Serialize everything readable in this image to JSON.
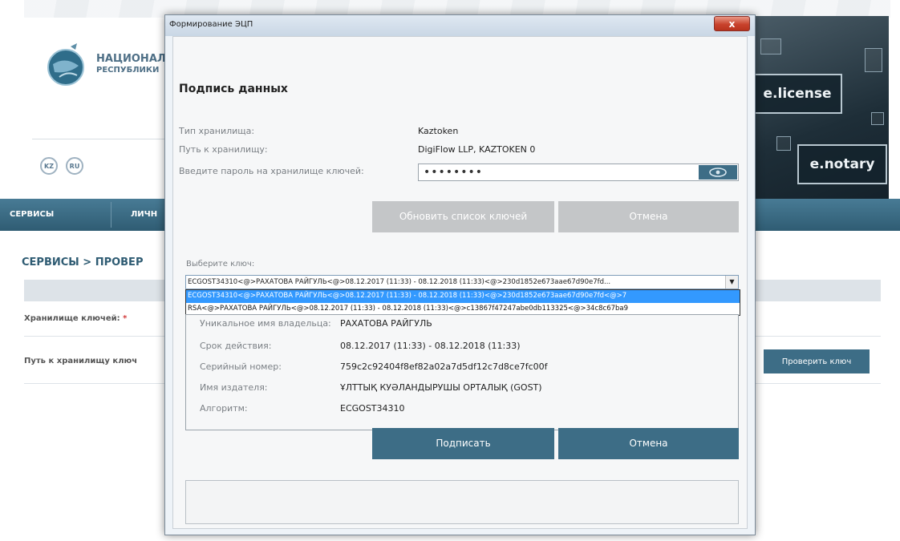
{
  "site": {
    "title": "НАЦИОНАЛ",
    "subtitle": "РЕСПУБЛИКИ",
    "lang_kz": "KZ",
    "lang_ru": "RU",
    "banner_license": "e.license",
    "banner_notary": "e.notary",
    "nav": [
      "СЕРВИСЫ",
      "ЛИЧН"
    ],
    "breadcrumb": "СЕРВИСЫ > ПРОВЕР",
    "label_storage": "Хранилище ключей:",
    "label_required": "*",
    "label_path": "Путь к хранилищу ключ",
    "check_button": "Проверить ключ"
  },
  "dialog": {
    "window_title": "Формирование ЭЦП",
    "close_label": "x",
    "heading": "Подпись данных",
    "storage_type_label": "Тип хранилища:",
    "storage_type_value": "Kaztoken",
    "storage_path_label": "Путь к хранилищу:",
    "storage_path_value": "DigiFlow LLP, KAZTOKEN 0",
    "password_label": "Введите пароль на хранилище ключей:",
    "password_value": "••••••••",
    "refresh_button": "Обновить список ключей",
    "cancel_top_button": "Отмена",
    "select_key_label": "Выберите ключ:",
    "selected_key": "ECGOST34310<@>РАХАТОВА РАЙГУЛЬ<@>08.12.2017 (11:33) - 08.12.2018 (11:33)<@>230d1852e673aae67d90e7fd...",
    "dropdown_options": [
      "ECGOST34310<@>РАХАТОВА РАЙГУЛЬ<@>08.12.2017 (11:33) - 08.12.2018 (11:33)<@>230d1852e673aae67d90e7fd<@>7",
      "RSA<@>РАХАТОВА РАЙГУЛЬ<@>08.12.2017 (11:33) - 08.12.2018 (11:33)<@>c13867f47247abe0db113325<@>34c8c67ba9"
    ],
    "info": [
      {
        "label": "Уникальное имя владельца:",
        "value": "РАХАТОВА РАЙГУЛЬ"
      },
      {
        "label": "Срок действия:",
        "value": "08.12.2017 (11:33) - 08.12.2018 (11:33)"
      },
      {
        "label": "Серийный номер:",
        "value": "759c2c92404f8ef82a02a7d5df12c7d8ce7fc00f"
      },
      {
        "label": "Имя издателя:",
        "value": "ҰЛТТЫҚ КУӘЛАНДЫРУШЫ ОРТАЛЫҚ (GOST)"
      },
      {
        "label": "Алгоритм:",
        "value": "ECGOST34310"
      }
    ],
    "sign_button": "Подписать",
    "cancel_button": "Отмена"
  },
  "colors": {
    "accent": "#3d6d86",
    "disabled": "#c4c6c8",
    "selection": "#3399ff",
    "close_red": "#c8432d"
  }
}
